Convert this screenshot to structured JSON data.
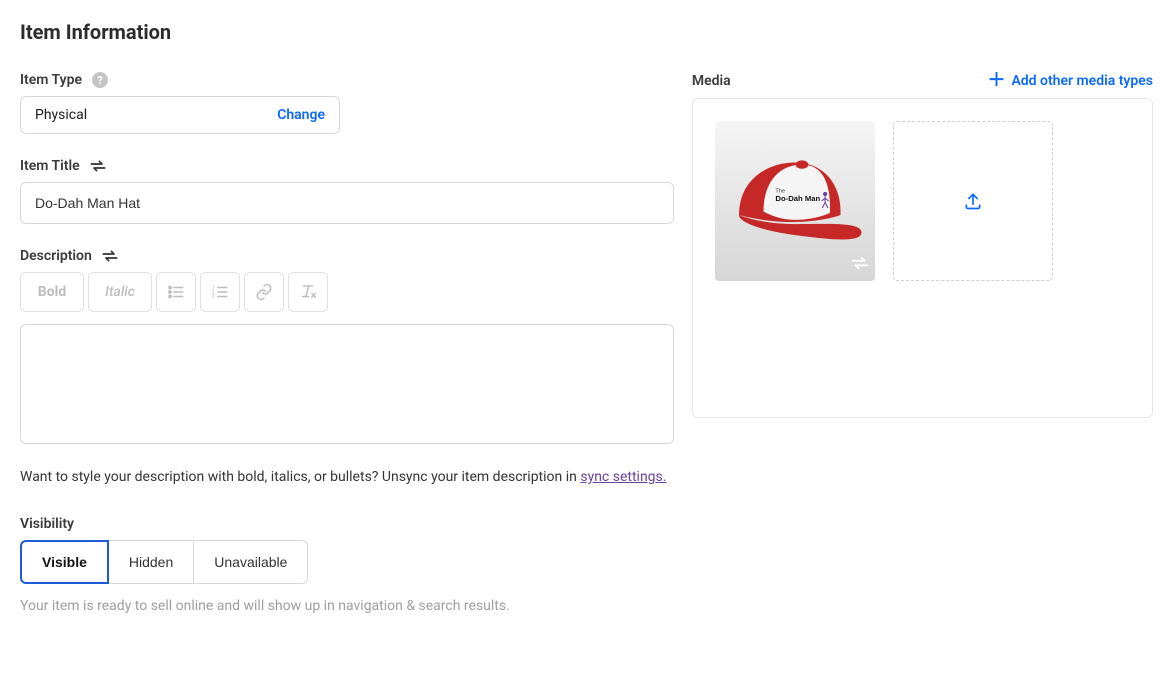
{
  "page": {
    "title": "Item Information"
  },
  "item_type": {
    "label": "Item Type",
    "value": "Physical",
    "change_label": "Change"
  },
  "item_title": {
    "label": "Item Title",
    "value": "Do-Dah Man Hat"
  },
  "description": {
    "label": "Description",
    "toolbar": {
      "bold": "Bold",
      "italic": "Italic"
    },
    "value": "",
    "sync_hint_prefix": "Want to style your description with bold, italics, or bullets? Unsync your item description in ",
    "sync_link_text": "sync settings."
  },
  "visibility": {
    "label": "Visibility",
    "options": {
      "visible": "Visible",
      "hidden": "Hidden",
      "unavailable": "Unavailable"
    },
    "selected": "visible",
    "help_text": "Your item is ready to sell online and will show up in navigation & search results."
  },
  "media": {
    "label": "Media",
    "add_label": "Add other media types",
    "thumbnail_alt": "Do-Dah Man Hat product image",
    "hat_logo_line1": "The",
    "hat_logo_line2": "Do-Dah Man"
  }
}
